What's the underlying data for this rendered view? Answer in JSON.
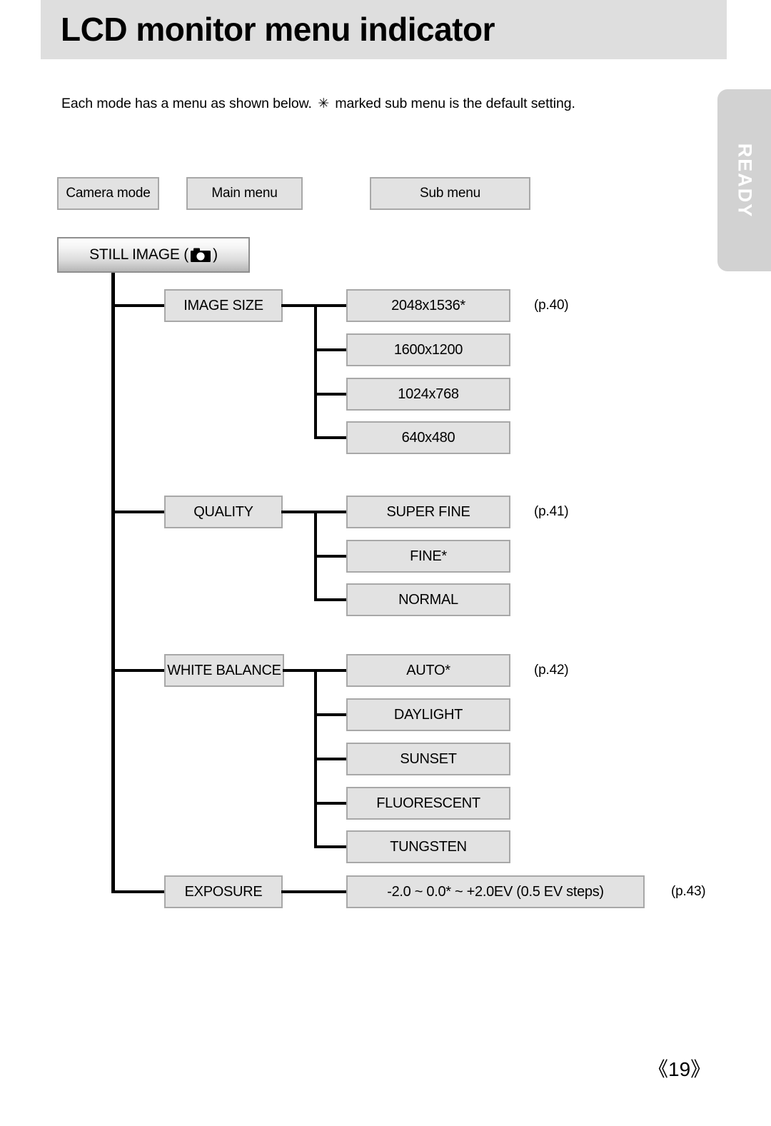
{
  "header": {
    "title": "LCD monitor menu indicator"
  },
  "intro": {
    "text_before": "Each mode has a menu as shown below.",
    "asterisk": "✳",
    "text_after": "marked sub menu is the default setting."
  },
  "side_tab": {
    "label": "READY",
    "color": "#d2d2d2",
    "text_color": "#ffffff"
  },
  "legend": {
    "camera_mode": "Camera mode",
    "main_menu": "Main menu",
    "sub_menu": "Sub menu"
  },
  "mode": {
    "label_prefix": "STILL IMAGE (",
    "icon": "camera-icon",
    "label_suffix": ")"
  },
  "colors": {
    "header_bg": "#dedede",
    "box_bg": "#e2e2e2",
    "box_border": "#a8a8a8",
    "line": "#000000"
  },
  "menu_tree": [
    {
      "main": "IMAGE SIZE",
      "page_ref": "(p.40)",
      "subs": [
        "2048x1536*",
        "1600x1200",
        "1024x768",
        "640x480"
      ]
    },
    {
      "main": "QUALITY",
      "page_ref": "(p.41)",
      "subs": [
        "SUPER FINE",
        "FINE*",
        "NORMAL"
      ]
    },
    {
      "main": "WHITE BALANCE",
      "page_ref": "(p.42)",
      "subs": [
        "AUTO*",
        "DAYLIGHT",
        "SUNSET",
        "FLUORESCENT",
        "TUNGSTEN"
      ]
    },
    {
      "main": "EXPOSURE",
      "page_ref": "(p.43)",
      "subs": [
        "-2.0 ~ 0.0* ~ +2.0EV (0.5 EV steps)"
      ]
    }
  ],
  "footer": {
    "page_number": "《19》"
  }
}
